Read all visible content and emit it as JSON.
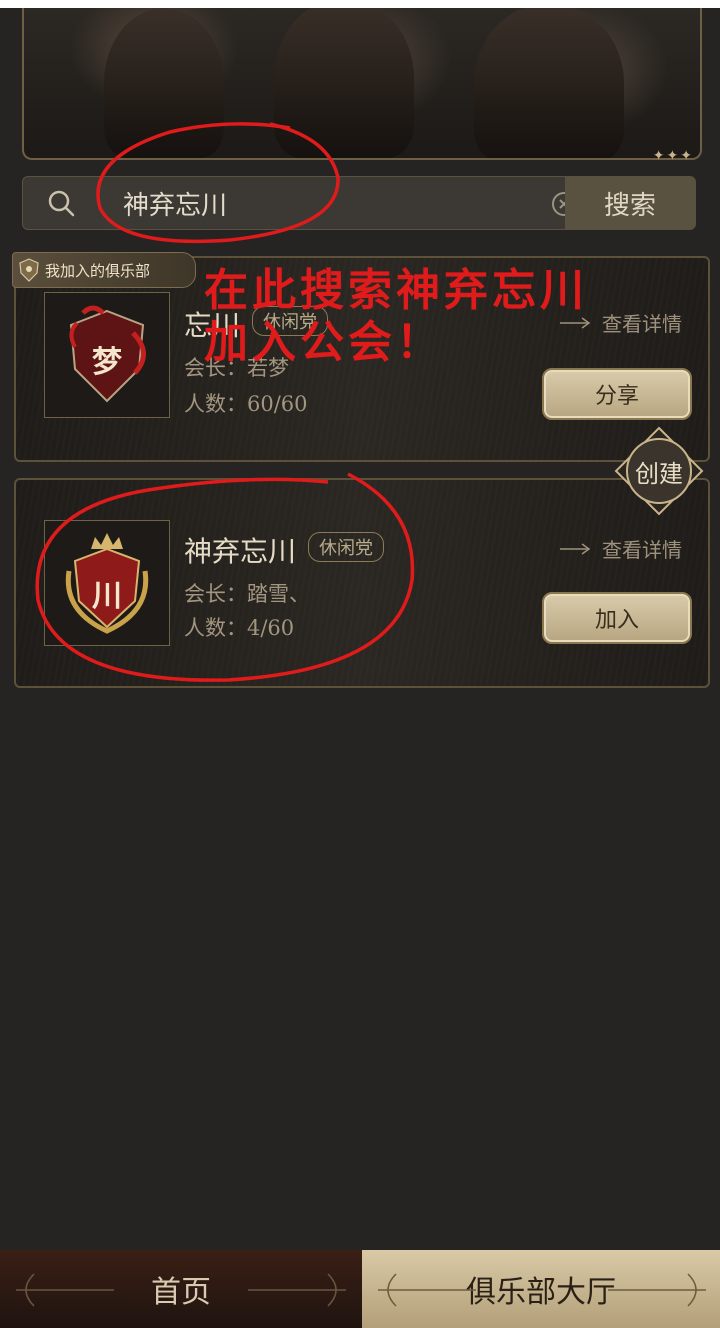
{
  "search": {
    "value": "神弃忘川",
    "button_label": "搜索"
  },
  "joined_tag_label": "我加入的俱乐部",
  "clubs": [
    {
      "emblem_char": "梦",
      "name": "忘川",
      "type": "休闲党",
      "leader": "会长：若梦",
      "members": "人数：60/60",
      "detail_label": "查看详情",
      "action_label": "分享"
    },
    {
      "emblem_char": "川",
      "name": "神弃忘川",
      "type": "休闲党",
      "leader": "会长：踏雪、",
      "members": "人数：4/60",
      "detail_label": "查看详情",
      "action_label": "加入"
    }
  ],
  "create_label": "创建",
  "annotation": {
    "line1": "在此搜索神弃忘川",
    "line2": "加入公会！"
  },
  "nav": {
    "home": "首页",
    "club_hall": "俱乐部大厅"
  },
  "colors": {
    "background": "#262422",
    "accent_gold": "#c9b48a",
    "annotation_red": "#e01b1b",
    "active_tab": "#c9b890"
  }
}
